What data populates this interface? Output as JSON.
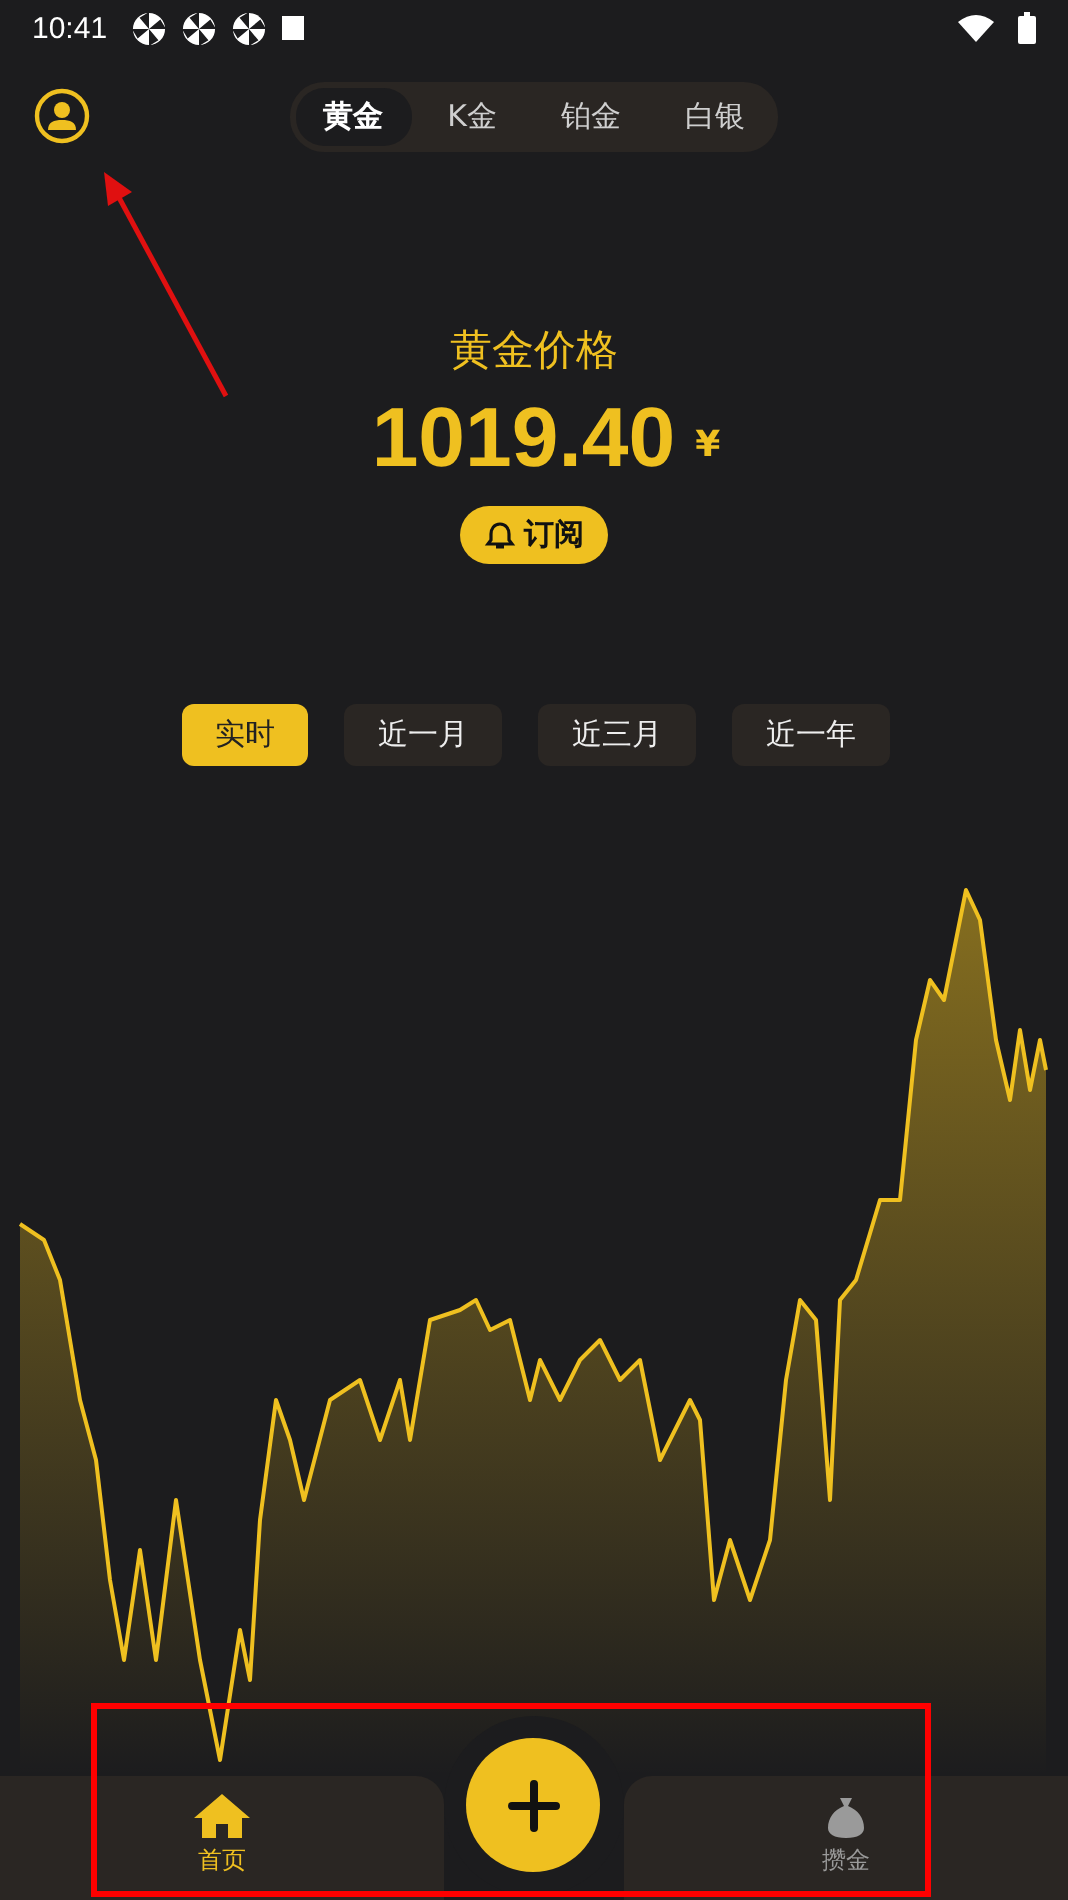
{
  "status_bar": {
    "time": "10:41"
  },
  "metal_tabs": [
    {
      "label": "黄金",
      "selected": true
    },
    {
      "label": "K金",
      "selected": false
    },
    {
      "label": "铂金",
      "selected": false
    },
    {
      "label": "白银",
      "selected": false
    }
  ],
  "price": {
    "title": "黄金价格",
    "value": "1019.40",
    "currency": "¥"
  },
  "subscribe_button": "订阅",
  "periods": [
    {
      "label": "实时",
      "selected": true
    },
    {
      "label": "近一月",
      "selected": false
    },
    {
      "label": "近三月",
      "selected": false
    },
    {
      "label": "近一年",
      "selected": false
    }
  ],
  "bottom_nav": [
    {
      "label": "首页",
      "kind": "home",
      "selected": true
    },
    {
      "label": "攒金",
      "kind": "savings",
      "selected": false
    }
  ]
}
